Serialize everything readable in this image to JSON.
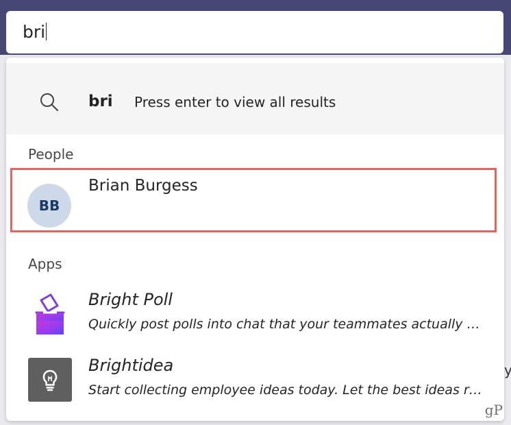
{
  "search": {
    "value": "bri"
  },
  "suggestion": {
    "query": "bri",
    "hint": "Press enter to view all results",
    "icon": "search-icon"
  },
  "people": {
    "section_label": "People",
    "items": [
      {
        "initials": "BB",
        "name": "Brian Burgess",
        "avatar_color": "#cdd9e9"
      }
    ]
  },
  "apps": {
    "section_label": "Apps",
    "items": [
      {
        "name": "Bright Poll",
        "description": "Quickly post polls into chat that your teammates actually respond to",
        "icon": "ballot-box-icon"
      },
      {
        "name": "Brightidea",
        "description": "Start collecting employee ideas today. Let the best ideas rise to the top",
        "icon": "lightbulb-icon"
      }
    ]
  },
  "background": {
    "partial_text": "y"
  },
  "watermark": "gP",
  "colors": {
    "header": "#464775",
    "highlight_border": "#e8615a",
    "suggestion_bg": "#f5f5f5"
  }
}
